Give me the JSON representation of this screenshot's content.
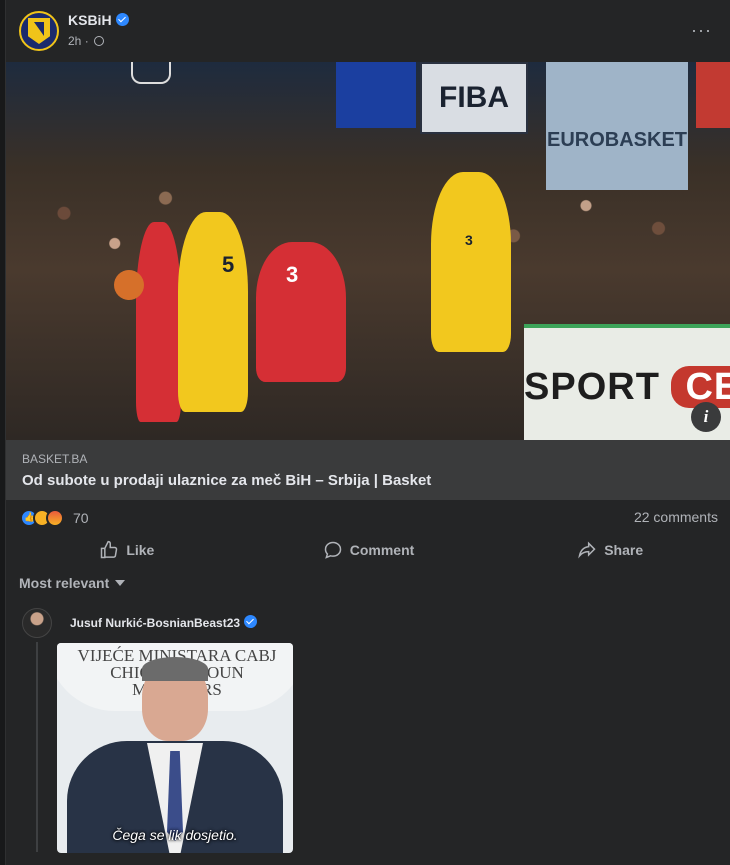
{
  "post": {
    "page_name": "KSBiH",
    "time": "2h",
    "more_label": "···"
  },
  "photo": {
    "banner_fiba": "FIBA",
    "banner_eurobasket": "EUROBASKET",
    "ad_text_left": "SPORT",
    "ad_text_right": "CEN",
    "jersey_left": "5",
    "jersey_center": "3",
    "jersey_right": "3",
    "info_label": "i"
  },
  "link": {
    "domain": "BASKET.BA",
    "title": "Od subote u prodaji ulaznice za meč BiH – Srbija | Basket"
  },
  "stats": {
    "reaction_count": "70",
    "comments": "22 comments"
  },
  "actions": {
    "like": "Like",
    "comment": "Comment",
    "share": "Share"
  },
  "sort": {
    "label": "Most relevant"
  },
  "comment": {
    "author": "Jusuf Nurkić-BosnianBeast23",
    "seal_text": "VIJEĆE MINISTARA CABJ CHICTAPA COUN MINISTERS",
    "caption": "Čega se lik dosjetio."
  },
  "colors": {
    "background": "#18191a",
    "card": "#242526",
    "link_box": "#3a3b3c",
    "verified": "#2d88ff",
    "text_primary": "#e4e6eb",
    "text_secondary": "#b0b3b8"
  }
}
